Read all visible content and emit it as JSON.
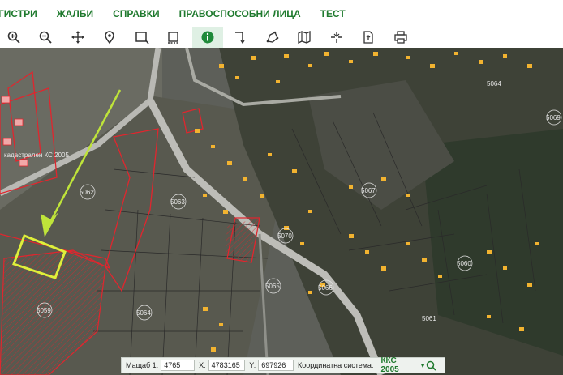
{
  "menu": {
    "items": [
      {
        "label": "ГИСТРИ"
      },
      {
        "label": "ЖАЛБИ"
      },
      {
        "label": "СПРАВКИ"
      },
      {
        "label": "ПРАВОСПОСОБНИ ЛИЦА"
      },
      {
        "label": "ТЕСТ"
      }
    ]
  },
  "toolbar": {
    "tools": [
      "zoom-in-icon",
      "zoom-out-icon",
      "pan-icon",
      "marker-icon",
      "select-rect-icon",
      "select-dash-icon",
      "info-icon",
      "measure-icon",
      "polygon-icon",
      "map-icon",
      "split-icon",
      "export-icon",
      "print-icon"
    ],
    "active_tool": "info-icon"
  },
  "map": {
    "parcel_labels": [
      "5062",
      "5064",
      "5063",
      "5059",
      "5070",
      "5065",
      "5066",
      "5067",
      "5060",
      "5069",
      "5064",
      "5061"
    ],
    "cadastral_label": "кадастрален КС 2005"
  },
  "status": {
    "scale_label": "Мащаб 1:",
    "scale_value": "4765",
    "x_label": "X:",
    "x_value": "4783165",
    "y_label": "Y:",
    "y_value": "697926",
    "system_label": "Координатна система:",
    "system_value": "ККС 2005",
    "system_arrow": "▼"
  },
  "colors": {
    "menu_text": "#1f7a2e",
    "parcel_red": "#e0262e",
    "building_yellow": "#f2b330",
    "arrow": "#bfe43a"
  }
}
